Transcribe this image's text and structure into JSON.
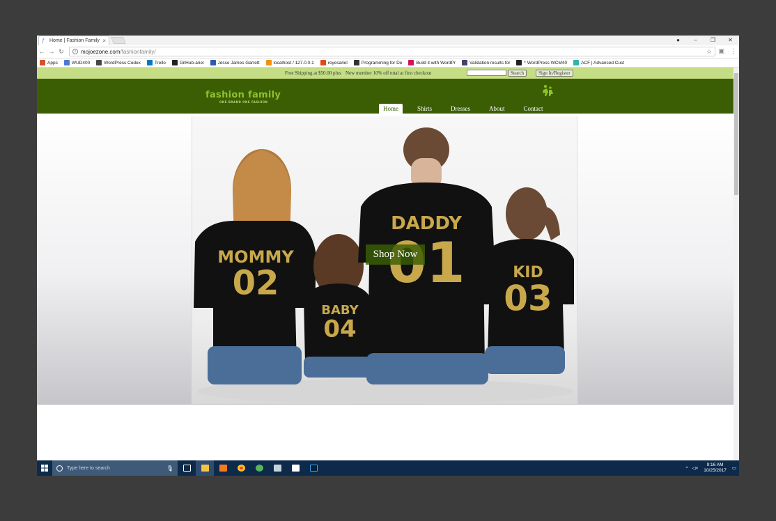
{
  "tab": {
    "title": "Home | Fashion Family"
  },
  "window_controls": [
    "–",
    "❐",
    "✕"
  ],
  "address": {
    "host": "mojoezone.com",
    "path": "/fashionfamily/"
  },
  "bookmarks": [
    {
      "label": "Apps",
      "color": "#d8512b"
    },
    {
      "label": "WUD400",
      "color": "#4a7bd0"
    },
    {
      "label": "WordPress Codex",
      "color": "#464646"
    },
    {
      "label": "Trello",
      "color": "#0079bf"
    },
    {
      "label": "GitHub-ariel",
      "color": "#222222"
    },
    {
      "label": "Jesse James Garrett",
      "color": "#2b5cb0"
    },
    {
      "label": "localhost / 127.0.0.1",
      "color": "#f29111"
    },
    {
      "label": "reyesariel",
      "color": "#e04a1b"
    },
    {
      "label": "Programming for De",
      "color": "#333333"
    },
    {
      "label": "Build it with WordPr",
      "color": "#d4145a"
    },
    {
      "label": "Validation results for",
      "color": "#444466"
    },
    {
      "label": "* WordPress WCM40",
      "color": "#222222"
    },
    {
      "label": "ACF | Advanced Cust",
      "color": "#2fb5b0"
    }
  ],
  "topbar": {
    "promo_shipping": "Free Shipping at $50.00 plus",
    "promo_member": "New member 10% off total at first checkout",
    "search_button": "Search",
    "signin": "Sign In/Register"
  },
  "site": {
    "logo": "fashion family",
    "tagline": "ONE BRAND   ONE FASHION",
    "nav": [
      "Home",
      "Shirts",
      "Dresses",
      "About",
      "Contact"
    ],
    "active_nav": "Home"
  },
  "hero": {
    "cta": "Shop Now",
    "shirts": [
      {
        "name": "MOMMY",
        "number": "02"
      },
      {
        "name": "BABY",
        "number": "04"
      },
      {
        "name": "DADDY",
        "number": "01"
      },
      {
        "name": "KID",
        "number": "03"
      }
    ]
  },
  "taskbar": {
    "search_placeholder": "Type here to search",
    "time": "9:16 AM",
    "date": "10/25/2017"
  },
  "colors": {
    "header_green": "#3b5e05",
    "strip_green": "#c5de86",
    "logo_green": "#8fc32a",
    "shirt_gold": "#c8a84b",
    "taskbar": "#0d2a4b"
  }
}
